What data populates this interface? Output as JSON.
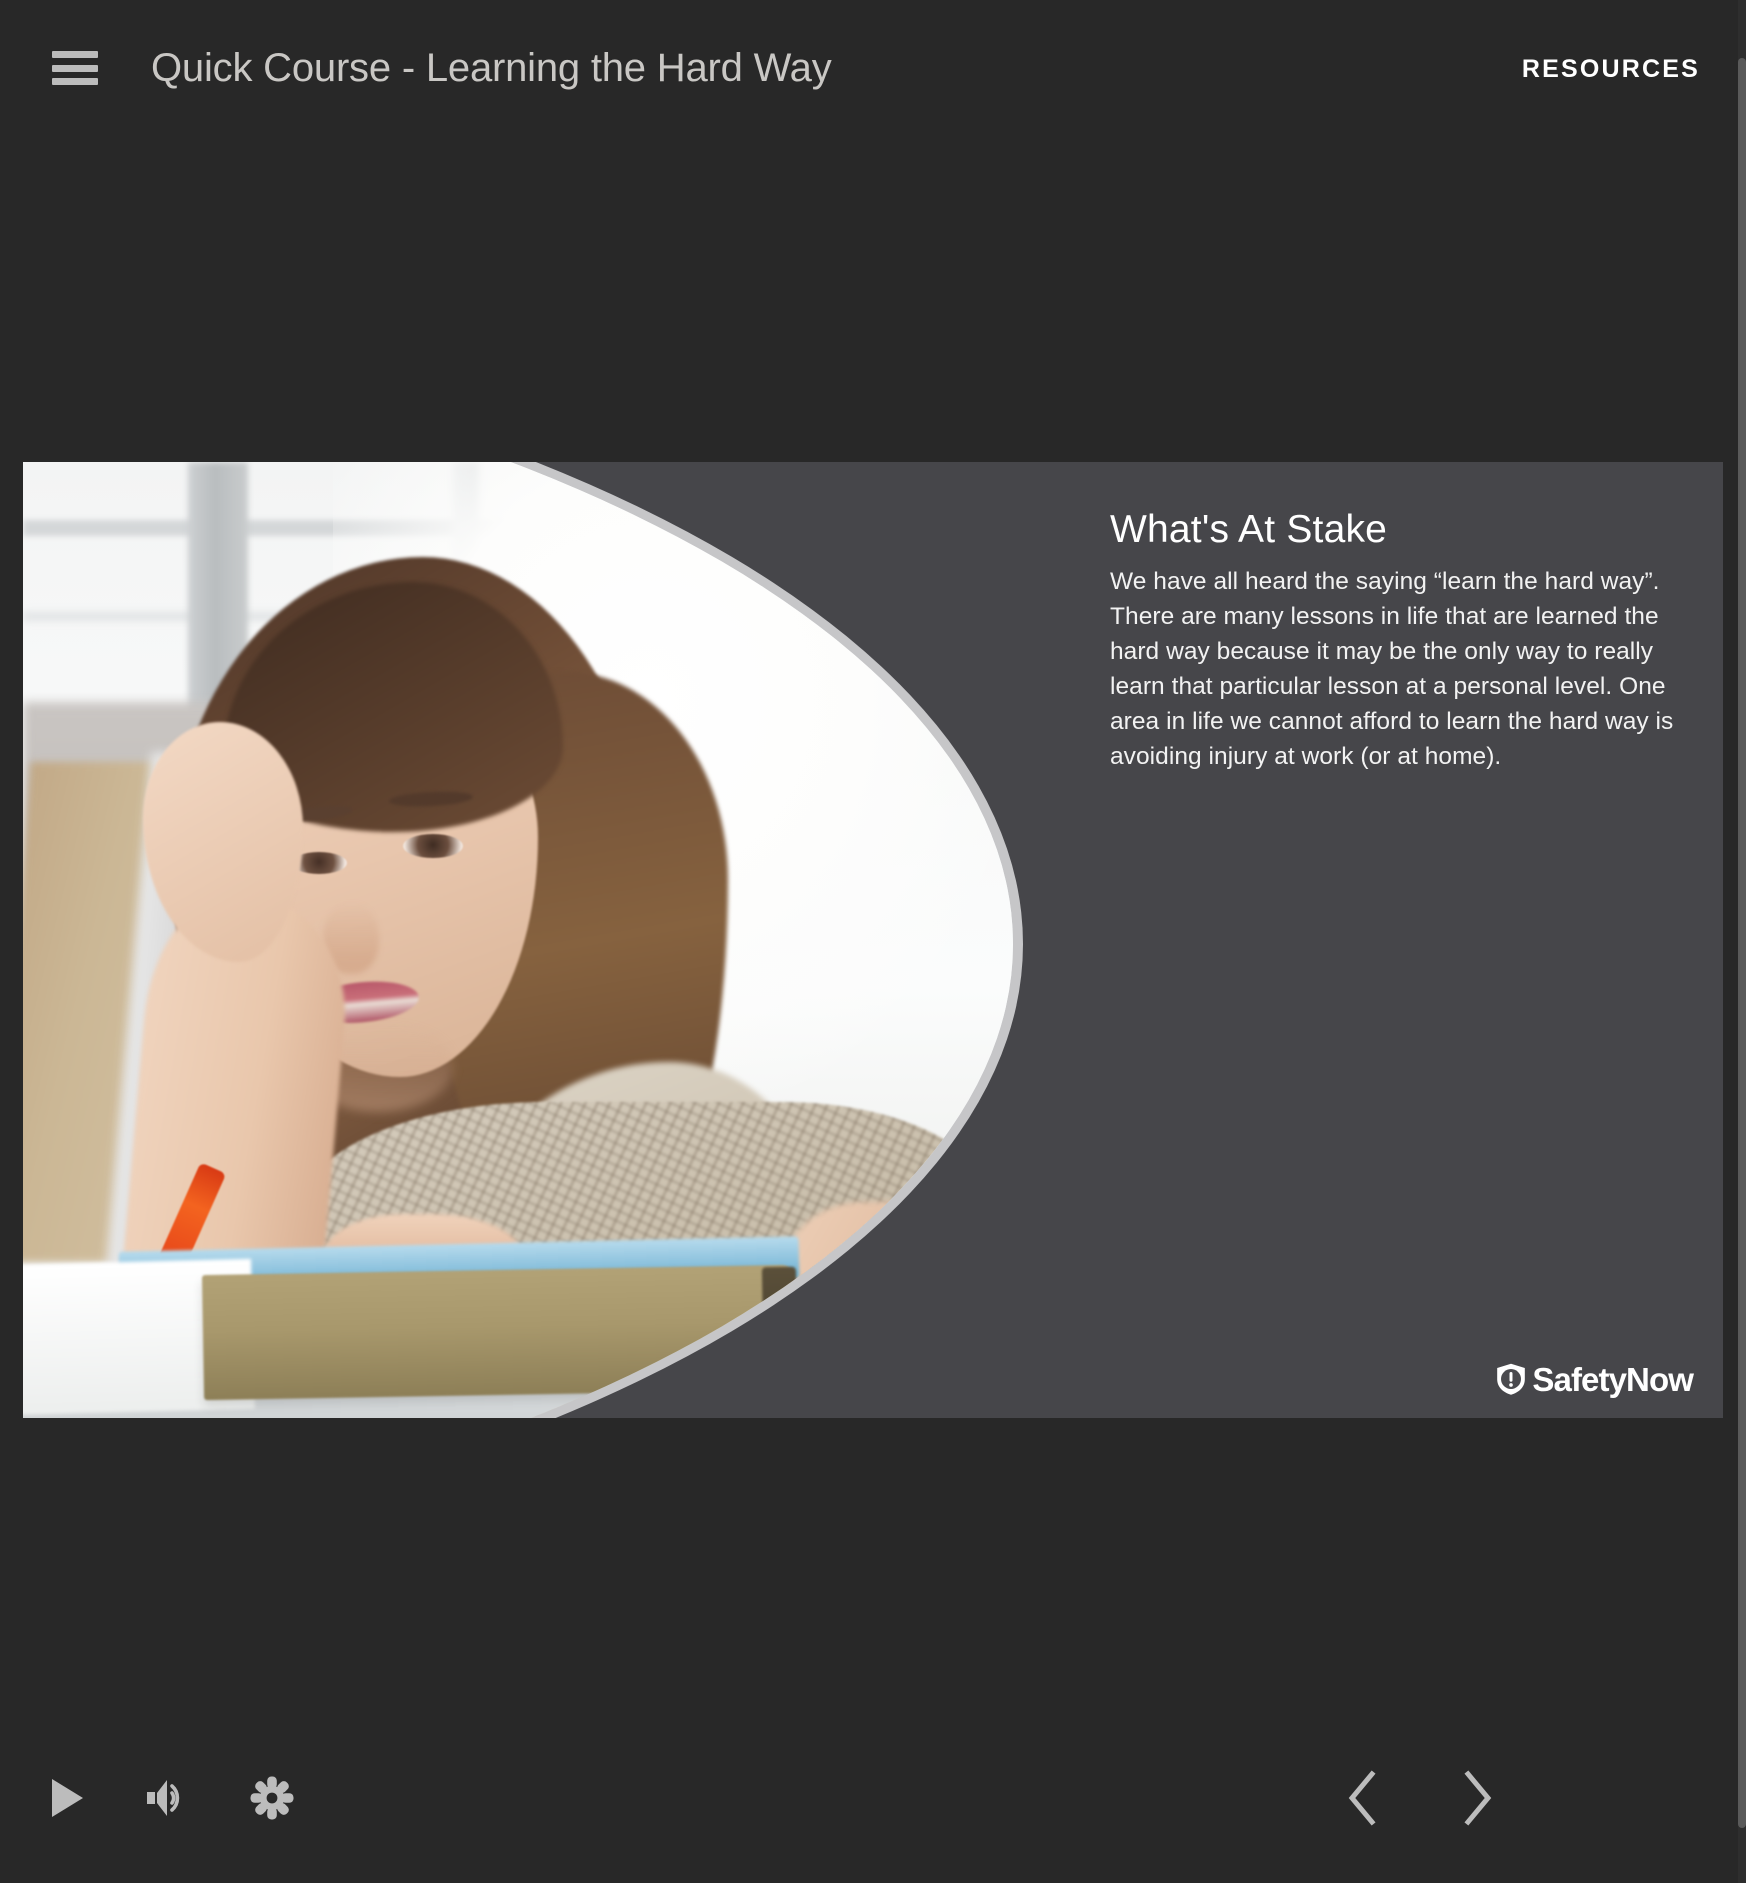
{
  "header": {
    "menu_icon": "hamburger-menu-icon",
    "title": "Quick Course - Learning the Hard Way",
    "resources_label": "RESOURCES"
  },
  "slide": {
    "heading": "What's At Stake",
    "body": "We have all heard the saying “learn the hard way”. There are many lessons in life that are learned the hard way because it may be the only way to really learn that particular lesson at a personal level. One area in life we cannot afford to learn the hard way is avoiding injury at work (or at home).",
    "image_alt": "Young woman at a desk resting her head on her hand, looking frustrated, with books, a notebook, a pen and a cup in front of her",
    "logo": {
      "icon": "safetynow-shield-icon",
      "wordmark": "SafetyNow"
    },
    "colors": {
      "slide_background": "#46464a",
      "photo_border": "#c6c6c8"
    }
  },
  "controls": {
    "play": {
      "label": "Play",
      "icon": "play-icon"
    },
    "volume": {
      "label": "Volume",
      "icon": "volume-icon"
    },
    "settings": {
      "label": "Settings",
      "icon": "gear-icon"
    },
    "previous": {
      "label": "Previous",
      "icon": "chevron-left-icon"
    },
    "next": {
      "label": "Next",
      "icon": "chevron-right-icon"
    }
  },
  "theme": {
    "page_background": "#282828",
    "title_color": "#c9c7c4",
    "icon_color": "#bcbcbc",
    "accent_text": "#ffffff"
  }
}
